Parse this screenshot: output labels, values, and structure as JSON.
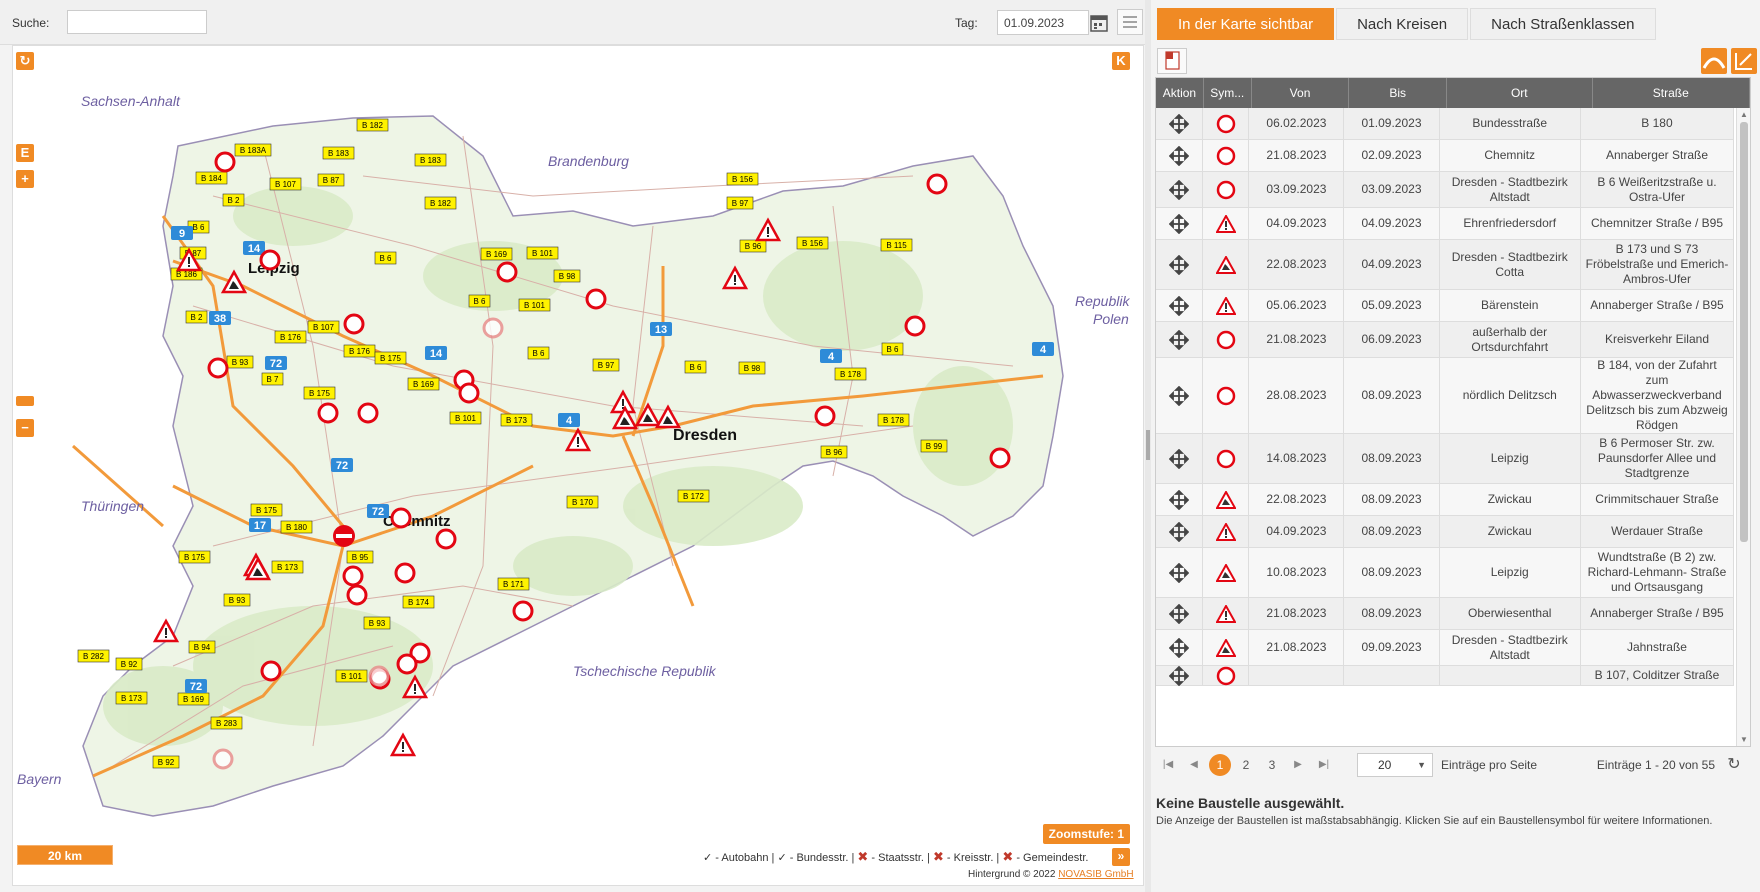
{
  "toolbar": {
    "search_label": "Suche:",
    "search_placeholder": "",
    "date_label": "Tag:",
    "date_value": "01.09.2023"
  },
  "map": {
    "labels": {
      "sachsen_anhalt": "Sachsen-Anhalt",
      "brandenburg": "Brandenburg",
      "polen": "Republik Polen",
      "thueringen": "Thüringen",
      "tschechien": "Tschechische Republik",
      "bayern": "Bayern",
      "leipzig": "Leipzig",
      "dresden": "Dresden",
      "chemnitz": "Chemnitz"
    },
    "button_k": "K",
    "button_e": "E",
    "button_plus": "+",
    "button_minus": "−",
    "zoom_level_text": "Zoomstufe: 1",
    "scalebar": "20 km",
    "legend": {
      "autobahn": "✓ - Autobahn |",
      "bundesstr": "✓ - Bundesstr. |",
      "staatsstr": "- Staatsstr. |",
      "kreisstr": "- Kreisstr. |",
      "gemeindestr": "- Gemeindestr."
    },
    "attribution_prefix": "Hintergrund © 2022",
    "attribution_link": "NOVASIB GmbH",
    "road_tags": [
      "B 182",
      "B 183A",
      "B 183",
      "B 183",
      "B 184",
      "B 107",
      "B 87",
      "B 2",
      "B 182",
      "B 6",
      "B 87",
      "B 156",
      "B 97",
      "B 96",
      "B 156",
      "B 115",
      "B 186",
      "B 6",
      "B 169",
      "B 101",
      "B 98",
      "B 101",
      "B 6",
      "B 2",
      "B 176",
      "B 107",
      "B 176",
      "B 175",
      "B 93",
      "B 7",
      "B 175",
      "B 169",
      "B 6",
      "B 97",
      "B 6",
      "B 98",
      "B 178",
      "B 6",
      "B 101",
      "B 173",
      "B 96",
      "B 178",
      "B 99",
      "B 170",
      "B 172",
      "B 175",
      "B 180",
      "B 95",
      "B 175",
      "B 173",
      "B 93",
      "B 171",
      "B 174",
      "B 93",
      "B 94",
      "B 282",
      "B 92",
      "B 101",
      "B 173",
      "B 169",
      "B 283",
      "B 92"
    ],
    "autobahn_tags": [
      "9",
      "14",
      "38",
      "72",
      "14",
      "13",
      "4",
      "4",
      "72",
      "4",
      "72",
      "17",
      "72"
    ]
  },
  "panel": {
    "tabs": [
      "In der Karte sichtbar",
      "Nach Kreisen",
      "Nach Straßenklassen"
    ],
    "columns": [
      "Aktion",
      "Sym...",
      "Von",
      "Bis",
      "Ort",
      "Straße"
    ],
    "rows": [
      {
        "sym": "closed",
        "von": "06.02.2023",
        "bis": "01.09.2023",
        "ort": "Bundesstraße",
        "strasse": "B 180"
      },
      {
        "sym": "closed",
        "von": "21.08.2023",
        "bis": "02.09.2023",
        "ort": "Chemnitz",
        "strasse": "Annaberger Straße"
      },
      {
        "sym": "closed",
        "von": "03.09.2023",
        "bis": "03.09.2023",
        "ort": "Dresden - Stadtbezirk Altstadt",
        "strasse": "B 6 Weißeritzstraße u. Ostra-Ufer"
      },
      {
        "sym": "warning",
        "von": "04.09.2023",
        "bis": "04.09.2023",
        "ort": "Ehrenfriedersdorf",
        "strasse": "Chemnitzer Straße / B95"
      },
      {
        "sym": "works",
        "von": "22.08.2023",
        "bis": "04.09.2023",
        "ort": "Dresden - Stadtbezirk Cotta",
        "strasse": "B 173 und S 73 Fröbelstraße und Emerich-Ambros-Ufer"
      },
      {
        "sym": "warning",
        "von": "05.06.2023",
        "bis": "05.09.2023",
        "ort": "Bärenstein",
        "strasse": "Annaberger Straße / B95"
      },
      {
        "sym": "closed",
        "von": "21.08.2023",
        "bis": "06.09.2023",
        "ort": "außerhalb der Ortsdurchfahrt",
        "strasse": "Kreisverkehr Eiland"
      },
      {
        "sym": "closed",
        "von": "28.08.2023",
        "bis": "08.09.2023",
        "ort": "nördlich Delitzsch",
        "strasse": "B 184, von der Zufahrt zum Abwasserzweckverband Delitzsch bis zum Abzweig Rödgen"
      },
      {
        "sym": "closed",
        "von": "14.08.2023",
        "bis": "08.09.2023",
        "ort": "Leipzig",
        "strasse": "B 6 Permoser Str. zw. Paunsdorfer Allee und Stadtgrenze"
      },
      {
        "sym": "works",
        "von": "22.08.2023",
        "bis": "08.09.2023",
        "ort": "Zwickau",
        "strasse": "Crimmitschauer Straße"
      },
      {
        "sym": "warning",
        "von": "04.09.2023",
        "bis": "08.09.2023",
        "ort": "Zwickau",
        "strasse": "Werdauer Straße"
      },
      {
        "sym": "works",
        "von": "10.08.2023",
        "bis": "08.09.2023",
        "ort": "Leipzig",
        "strasse": "Wundtstraße (B 2) zw. Richard-Lehmann- Straße und Ortsausgang"
      },
      {
        "sym": "warning",
        "von": "21.08.2023",
        "bis": "08.09.2023",
        "ort": "Oberwiesenthal",
        "strasse": "Annaberger Straße / B95"
      },
      {
        "sym": "works",
        "von": "21.08.2023",
        "bis": "09.09.2023",
        "ort": "Dresden - Stadtbezirk Altstadt",
        "strasse": "Jahnstraße"
      },
      {
        "sym": "closed",
        "von": "",
        "bis": "",
        "ort": "",
        "strasse": "B 107, Colditzer Straße"
      }
    ],
    "pager": {
      "pages": [
        "1",
        "2",
        "3"
      ],
      "page_size": "20",
      "per_page_label": "Einträge pro Seite",
      "entries_text": "Einträge 1 - 20 von 55"
    },
    "info_title": "Keine Baustelle ausgewählt.",
    "info_text": "Die Anzeige der Baustellen ist maßstabsabhängig. Klicken Sie auf ein Baustellensymbol für weitere Informationen."
  }
}
